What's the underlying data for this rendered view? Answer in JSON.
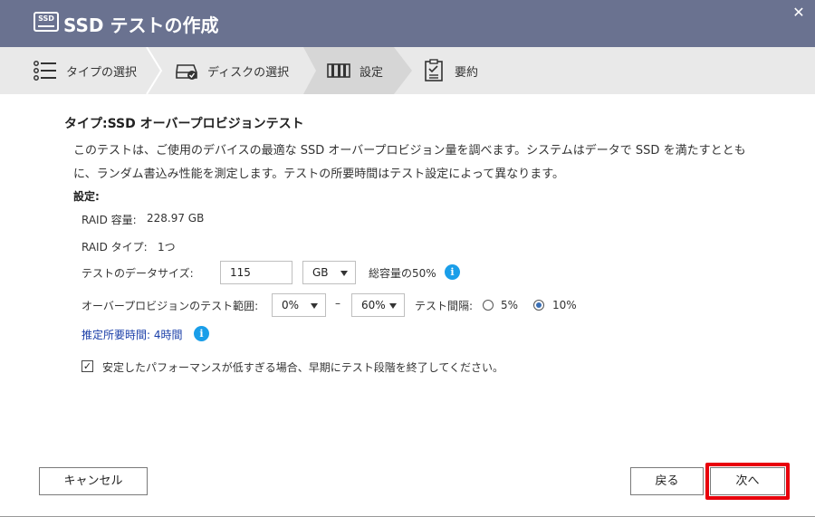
{
  "window": {
    "icon_text": "SSD",
    "title": "SSD テストの作成"
  },
  "steps": [
    {
      "label": "タイプの選択",
      "icon": "list-icon"
    },
    {
      "label": "ディスクの選択",
      "icon": "disk-check-icon"
    },
    {
      "label": "設定",
      "icon": "settings-icon",
      "active": true
    },
    {
      "label": "要約",
      "icon": "summary-icon"
    }
  ],
  "content": {
    "heading": "タイプ:SSD オーバープロビジョンテスト",
    "description": "このテストは、ご使用のデバイスの最適な SSD オーバープロビジョン量を調べます。システムはデータで SSD を満たすとともに、ランダム書込み性能を測定します。テストの所要時間はテスト設定によって異なります。",
    "settings_label": "設定:",
    "raid_capacity_label": "RAID 容量:",
    "raid_capacity_value": "228.97 GB",
    "raid_type_label": "RAID タイプ:",
    "raid_type_value": "1つ",
    "data_size_label": "テストのデータサイズ:",
    "data_size_value": "115",
    "data_size_unit": "GB",
    "data_size_note": "総容量の50%",
    "range_label": "オーバープロビジョンのテスト範囲:",
    "range_from": "0%",
    "range_sep": "–",
    "range_to": "60%",
    "interval_label": "テスト間隔:",
    "interval_options": [
      {
        "label": "5%",
        "checked": false
      },
      {
        "label": "10%",
        "checked": true
      }
    ],
    "estimated_time": "推定所要時間: 4時間",
    "early_stop_checked": true,
    "early_stop_label": "安定したパフォーマンスが低すぎる場合、早期にテスト段階を終了してください。"
  },
  "footer": {
    "cancel": "キャンセル",
    "back": "戻る",
    "next": "次へ"
  },
  "colors": {
    "titlebar": "#6a7290",
    "info": "#1a9ee9",
    "highlight": "#e8000b",
    "link": "#1a3ea8"
  }
}
